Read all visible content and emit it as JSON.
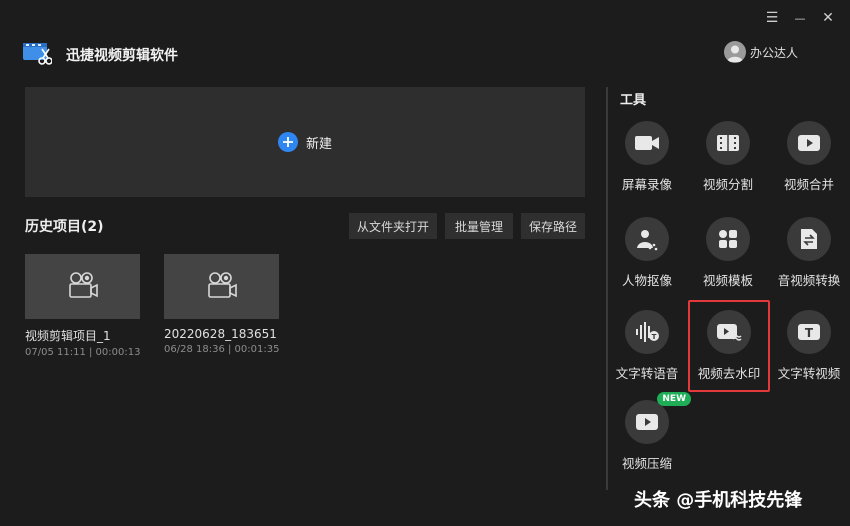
{
  "app": {
    "title": "迅捷视频剪辑软件"
  },
  "window_controls": {
    "menu": "☰",
    "minimize": "—",
    "close": "✕"
  },
  "user": {
    "name": "办公达人"
  },
  "new_project": {
    "label": "新建"
  },
  "history": {
    "title": "历史项目(2)",
    "buttons": [
      "从文件夹打开",
      "批量管理",
      "保存路径"
    ],
    "projects": [
      {
        "name": "视频剪辑项目_1",
        "meta": "07/05 11:11 | 00:00:13"
      },
      {
        "name": "20220628_183651",
        "meta": "06/28 18:36 | 00:01:35"
      }
    ]
  },
  "tools": {
    "title": "工具",
    "items": [
      {
        "label": "屏幕录像",
        "icon": "camera-icon"
      },
      {
        "label": "视频分割",
        "icon": "film-split-icon"
      },
      {
        "label": "视频合并",
        "icon": "video-play-icon"
      },
      {
        "label": "人物抠像",
        "icon": "person-cutout-icon"
      },
      {
        "label": "视频模板",
        "icon": "template-grid-icon"
      },
      {
        "label": "音视频转换",
        "icon": "convert-icon"
      },
      {
        "label": "文字转语音",
        "icon": "text-to-speech-icon"
      },
      {
        "label": "视频去水印",
        "icon": "remove-watermark-icon",
        "highlighted": true
      },
      {
        "label": "文字转视频",
        "icon": "text-to-video-icon"
      },
      {
        "label": "视频压缩",
        "icon": "compress-video-icon",
        "badge": "NEW"
      }
    ]
  },
  "watermark": {
    "text": "头条 @手机科技先锋"
  },
  "colors": {
    "accent": "#2f86f0",
    "highlight": "#e23a3a",
    "badge": "#1fae57",
    "background": "#1c1c1c"
  }
}
